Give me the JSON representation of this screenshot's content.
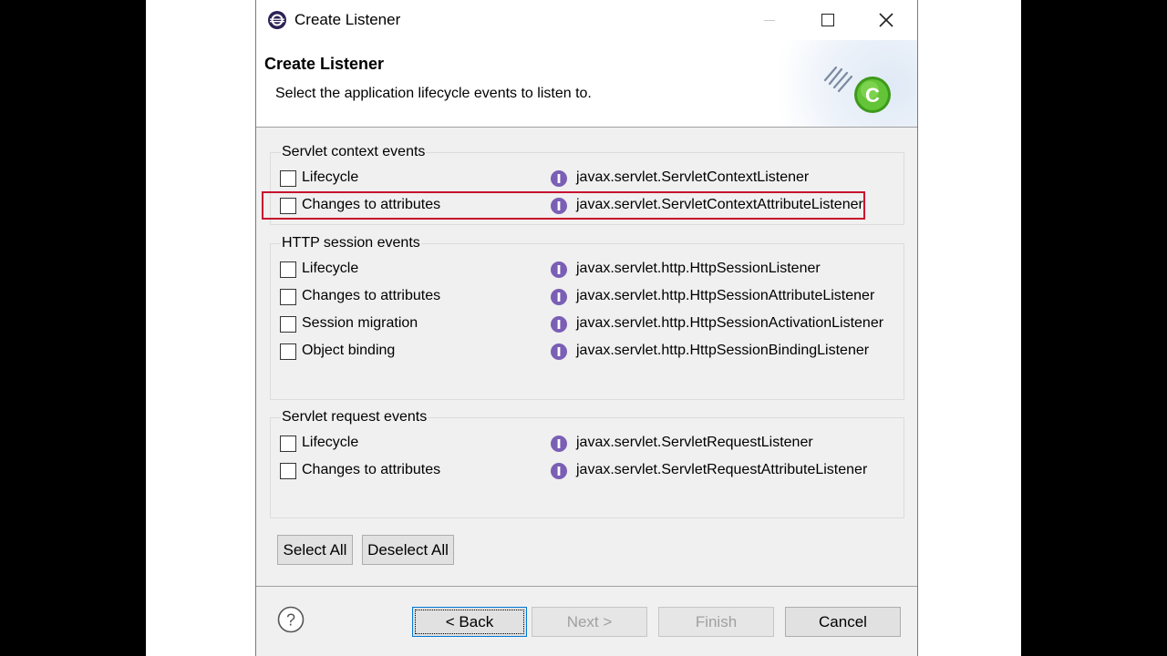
{
  "window": {
    "title": "Create Listener"
  },
  "header": {
    "title": "Create Listener",
    "description": "Select the application lifecycle events to listen to."
  },
  "groups": [
    {
      "label": "Servlet context events",
      "items": [
        {
          "label": "Lifecycle",
          "class": "javax.servlet.ServletContextListener",
          "checked": false
        },
        {
          "label": "Changes to attributes",
          "class": "javax.servlet.ServletContextAttributeListener",
          "checked": false
        }
      ]
    },
    {
      "label": "HTTP session events",
      "items": [
        {
          "label": "Lifecycle",
          "class": "javax.servlet.http.HttpSessionListener",
          "checked": false
        },
        {
          "label": "Changes to attributes",
          "class": "javax.servlet.http.HttpSessionAttributeListener",
          "checked": false
        },
        {
          "label": "Session migration",
          "class": "javax.servlet.http.HttpSessionActivationListener",
          "checked": false
        },
        {
          "label": "Object binding",
          "class": "javax.servlet.http.HttpSessionBindingListener",
          "checked": false
        }
      ]
    },
    {
      "label": "Servlet request events",
      "items": [
        {
          "label": "Lifecycle",
          "class": "javax.servlet.ServletRequestListener",
          "checked": false
        },
        {
          "label": "Changes to attributes",
          "class": "javax.servlet.ServletRequestAttributeListener",
          "checked": false
        }
      ]
    }
  ],
  "selection": {
    "select_all": "Select All",
    "deselect_all": "Deselect All"
  },
  "footer": {
    "back": "< Back",
    "next": "Next >",
    "finish": "Finish",
    "cancel": "Cancel"
  },
  "icons": {
    "interface": "interface-icon",
    "help": "help-icon",
    "app": "eclipse-icon"
  },
  "colors": {
    "highlight": "#c8102e",
    "interface_icon": "#7a5fb5",
    "wizard_accent": "#5cb82e"
  }
}
